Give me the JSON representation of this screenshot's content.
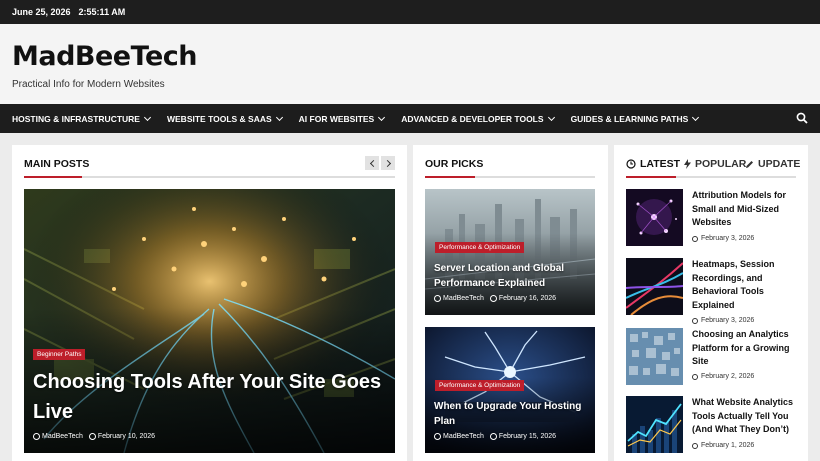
{
  "topbar": {
    "date": "June 25, 2026",
    "time": "2:55:11 AM"
  },
  "site": {
    "title": "MadBeeTech",
    "tagline": "Practical Info for Modern Websites"
  },
  "nav": {
    "items": [
      {
        "label": "HOSTING & INFRASTRUCTURE"
      },
      {
        "label": "WEBSITE TOOLS & SAAS"
      },
      {
        "label": "AI FOR WEBSITES"
      },
      {
        "label": "ADVANCED & DEVELOPER TOOLS"
      },
      {
        "label": "GUIDES & LEARNING PATHS"
      }
    ],
    "search_icon": "search-icon"
  },
  "main_posts": {
    "heading": "MAIN POSTS",
    "featured": {
      "category": "Beginner Paths",
      "title": "Choosing Tools After Your Site Goes Live",
      "author": "MadBeeTech",
      "date": "February 10, 2026"
    }
  },
  "our_picks": {
    "heading": "OUR PICKS",
    "posts": [
      {
        "category": "Performance & Optimization",
        "title": "Server Location and Global Performance Explained",
        "author": "MadBeeTech",
        "date": "February 16, 2026"
      },
      {
        "category": "Performance & Optimization",
        "title": "When to Upgrade Your Hosting Plan",
        "author": "MadBeeTech",
        "date": "February 15, 2026"
      }
    ]
  },
  "sidebar": {
    "tabs": [
      {
        "label": "LATEST",
        "icon": "clock-icon"
      },
      {
        "label": "POPULAR",
        "icon": "bolt-icon"
      },
      {
        "label": "UPDATE",
        "icon": "pencil-icon"
      }
    ],
    "items": [
      {
        "title": "Attribution Models for Small and Mid-Sized Websites",
        "date": "February 3, 2026"
      },
      {
        "title": "Heatmaps, Session Recordings, and Behavioral Tools Explained",
        "date": "February 3, 2026"
      },
      {
        "title": "Choosing an Analytics Platform for a Growing Site",
        "date": "February 2, 2026"
      },
      {
        "title": "What Website Analytics Tools Actually Tell You (And What They Don’t)",
        "date": "February 1, 2026"
      }
    ]
  },
  "colors": {
    "accent": "#bd1e2a",
    "dark": "#1d1d1d"
  }
}
